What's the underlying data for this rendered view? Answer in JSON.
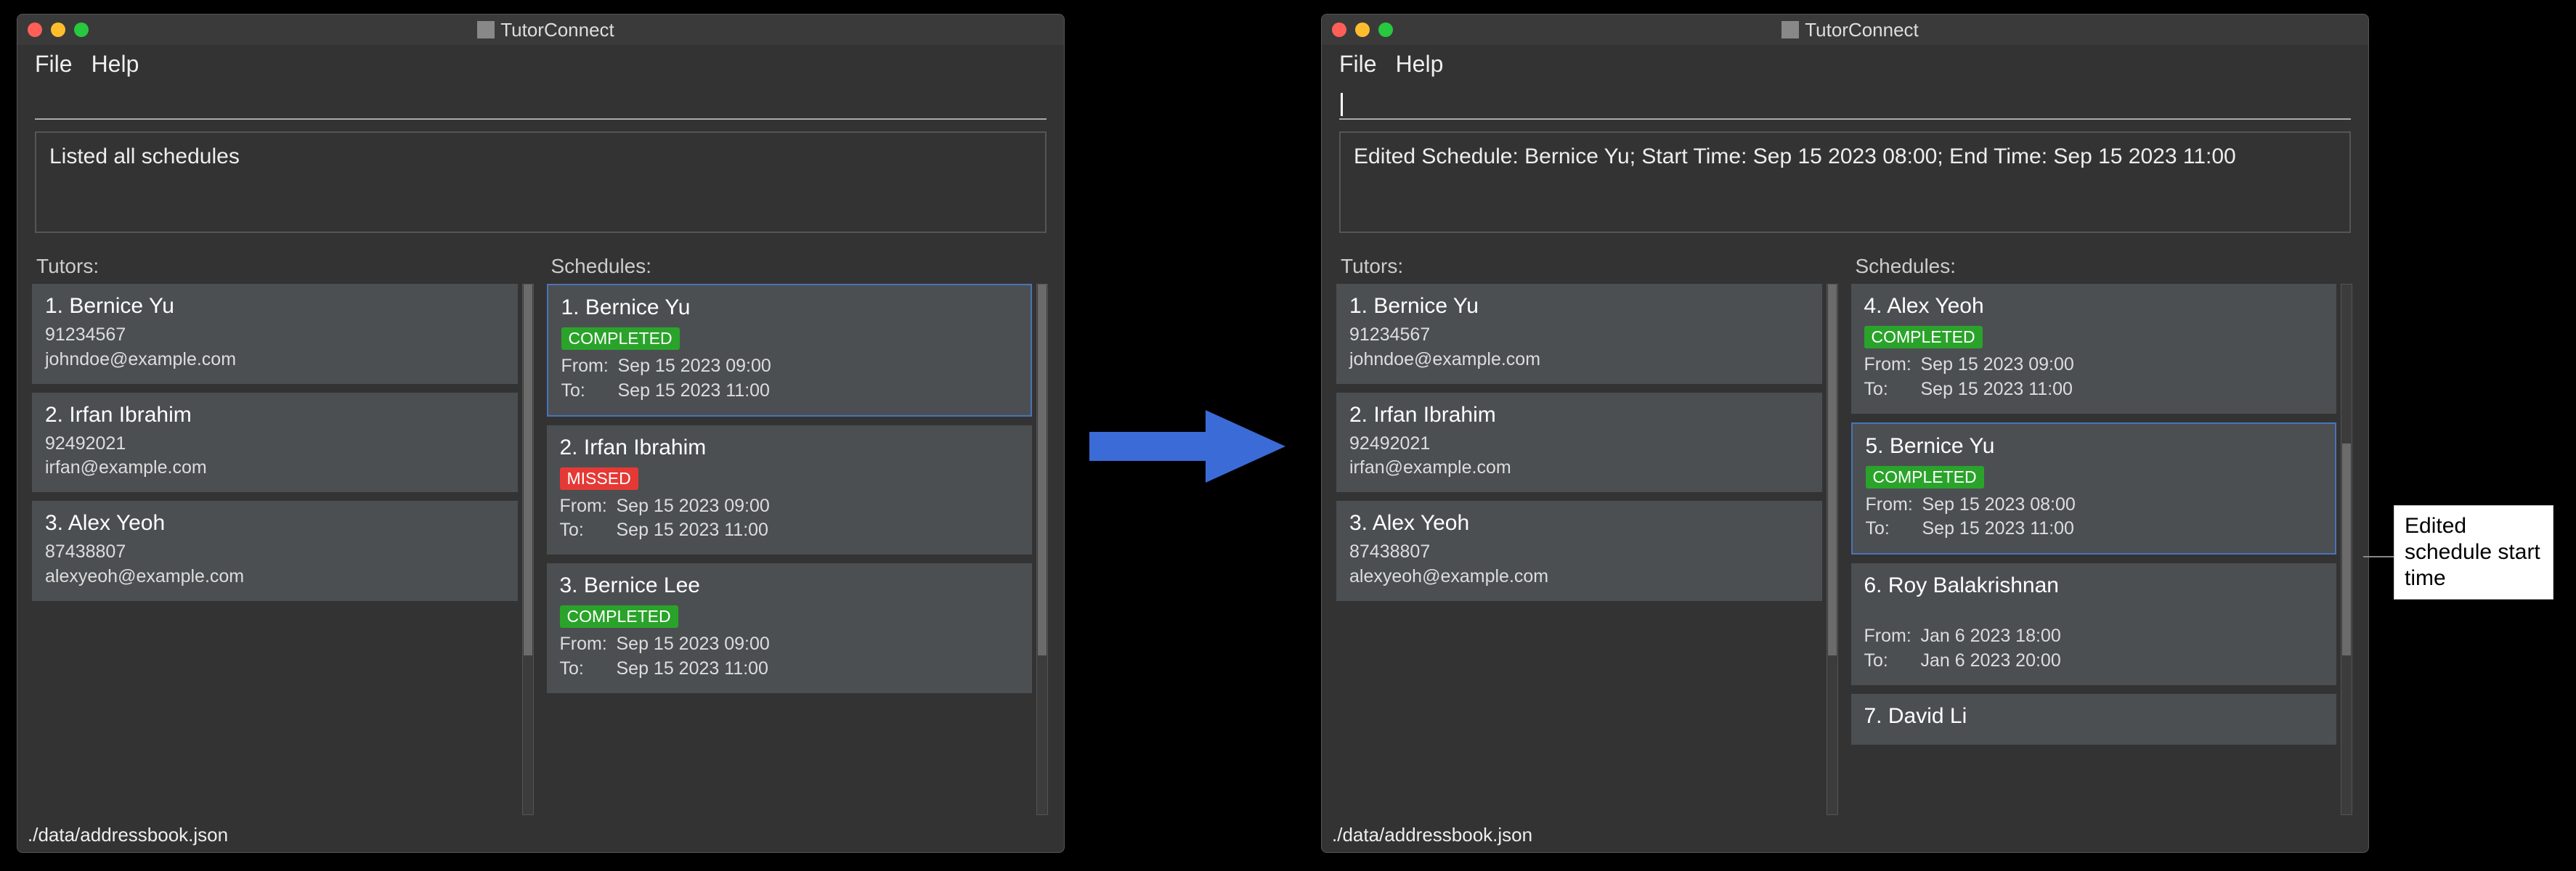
{
  "app_title": "TutorConnect",
  "menu": {
    "file": "File",
    "help": "Help"
  },
  "statusbar": "./data/addressbook.json",
  "labels": {
    "tutors": "Tutors:",
    "schedules": "Schedules:",
    "from": "From:",
    "to": "To:"
  },
  "left": {
    "result": "Listed all schedules",
    "tutors": [
      {
        "idx": "1.",
        "name": "Bernice Yu",
        "phone": "91234567",
        "email": "johndoe@example.com"
      },
      {
        "idx": "2.",
        "name": "Irfan Ibrahim",
        "phone": "92492021",
        "email": "irfan@example.com"
      },
      {
        "idx": "3.",
        "name": "Alex Yeoh",
        "phone": "87438807",
        "email": "alexyeoh@example.com"
      }
    ],
    "schedules": [
      {
        "idx": "1.",
        "name": "Bernice Yu",
        "status": "COMPLETED",
        "from": "Sep 15 2023 09:00",
        "to": "Sep 15 2023 11:00",
        "selected": true
      },
      {
        "idx": "2.",
        "name": "Irfan Ibrahim",
        "status": "MISSED",
        "from": "Sep 15 2023 09:00",
        "to": "Sep 15 2023 11:00"
      },
      {
        "idx": "3.",
        "name": "Bernice Lee",
        "status": "COMPLETED",
        "from": "Sep 15 2023 09:00",
        "to": "Sep 15 2023 11:00"
      }
    ]
  },
  "right": {
    "result": "Edited Schedule: Bernice Yu; Start Time: Sep 15 2023 08:00; End Time: Sep 15 2023 11:00",
    "tutors": [
      {
        "idx": "1.",
        "name": "Bernice Yu",
        "phone": "91234567",
        "email": "johndoe@example.com"
      },
      {
        "idx": "2.",
        "name": "Irfan Ibrahim",
        "phone": "92492021",
        "email": "irfan@example.com"
      },
      {
        "idx": "3.",
        "name": "Alex Yeoh",
        "phone": "87438807",
        "email": "alexyeoh@example.com"
      }
    ],
    "schedules": [
      {
        "idx": "4.",
        "name": "Alex Yeoh",
        "status": "COMPLETED",
        "from": "Sep 15 2023 09:00",
        "to": "Sep 15 2023 11:00"
      },
      {
        "idx": "5.",
        "name": "Bernice Yu",
        "status": "COMPLETED",
        "from": "Sep 15 2023 08:00",
        "to": "Sep 15 2023 11:00",
        "selected": true
      },
      {
        "idx": "6.",
        "name": "Roy Balakrishnan",
        "status": "",
        "from": "Jan 6 2023 18:00",
        "to": "Jan 6 2023 20:00"
      },
      {
        "idx": "7.",
        "name": "David Li",
        "partial": true
      }
    ]
  },
  "callout": "Edited schedule start time"
}
